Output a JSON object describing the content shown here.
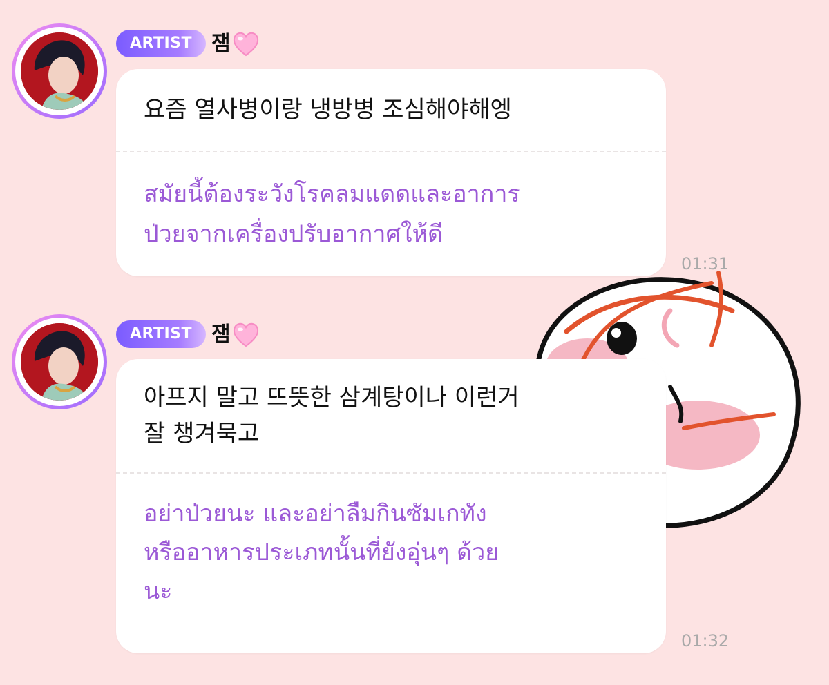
{
  "messages": [
    {
      "badge": "ARTIST",
      "name": "잼",
      "text": "요즘 열사병이랑 냉방병 조심해야해엥",
      "translation": "สมัยนี้ต้องระวังโรคลมแดดและอาการ\nป่วยจากเครื่องปรับอากาศให้ดี",
      "time": "01:31"
    },
    {
      "badge": "ARTIST",
      "name": "잼",
      "text": "아프지 말고 뜨뜻한 삼계탕이나 이런거\n잘 챙겨묵고",
      "translation": "อย่าป่วยนะ และอย่าลืมกินซัมเกทัง\nหรืออาหารประเภทนั้นที่ยังอุ่นๆ ด้วย\nนะ",
      "time": "01:32"
    }
  ],
  "icons": {
    "name_suffix": "pink-heart-icon",
    "avatar": "artist-avatar",
    "background": "sticker-face"
  },
  "colors": {
    "background": "#fde3e3",
    "badge": "#8a63ff",
    "translation_text": "#9b59d6",
    "time_text": "#a9a9a9"
  }
}
